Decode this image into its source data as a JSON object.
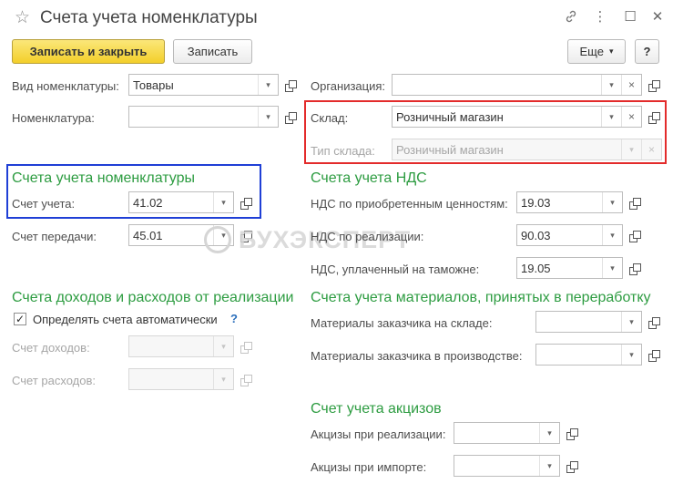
{
  "window": {
    "title": "Счета учета номенклатуры"
  },
  "toolbar": {
    "save_close": "Записать и закрыть",
    "save": "Записать",
    "more": "Еще",
    "help": "?"
  },
  "left": {
    "vid_label": "Вид номенклатуры:",
    "vid_value": "Товары",
    "nom_label": "Номенклатура:",
    "nom_value": "",
    "section_accounts": "Счета учета номенклатуры",
    "account_label": "Счет учета:",
    "account_value": "41.02",
    "transfer_label": "Счет передачи:",
    "transfer_value": "45.01",
    "section_income": "Счета доходов и расходов от реализации",
    "auto_label": "Определять счета автоматически",
    "auto_checked": "✓",
    "auto_help": "?",
    "income_label": "Счет доходов:",
    "expense_label": "Счет расходов:"
  },
  "right": {
    "org_label": "Организация:",
    "org_value": "",
    "warehouse_label": "Склад:",
    "warehouse_value": "Розничный магазин",
    "whtype_label": "Тип склада:",
    "whtype_value": "Розничный магазин",
    "section_vat": "Счета учета НДС",
    "vat_purchase_label": "НДС по приобретенным ценностям:",
    "vat_purchase_value": "19.03",
    "vat_sales_label": "НДС по реализации:",
    "vat_sales_value": "90.03",
    "vat_customs_label": "НДС, уплаченный на таможне:",
    "vat_customs_value": "19.05",
    "section_materials": "Счета учета материалов, принятых в переработку",
    "mat_warehouse_label": "Материалы заказчика на складе:",
    "mat_production_label": "Материалы заказчика в производстве:",
    "section_excise": "Счет учета акцизов",
    "excise_sales_label": "Акцизы при реализации:",
    "excise_import_label": "Акцизы при импорте:"
  },
  "watermark": "БУХЭКСПЕРТ",
  "icons": {
    "dropdown": "▾",
    "clear": "×",
    "star": "☆",
    "link": "🔗",
    "more": "⋮",
    "maximize": "☐",
    "close": "✕"
  },
  "colors": {
    "section": "#2d9c41",
    "highlight_red": "#e32b2b",
    "highlight_blue": "#1f3fd6",
    "primary_button": "#f3cf2a"
  }
}
